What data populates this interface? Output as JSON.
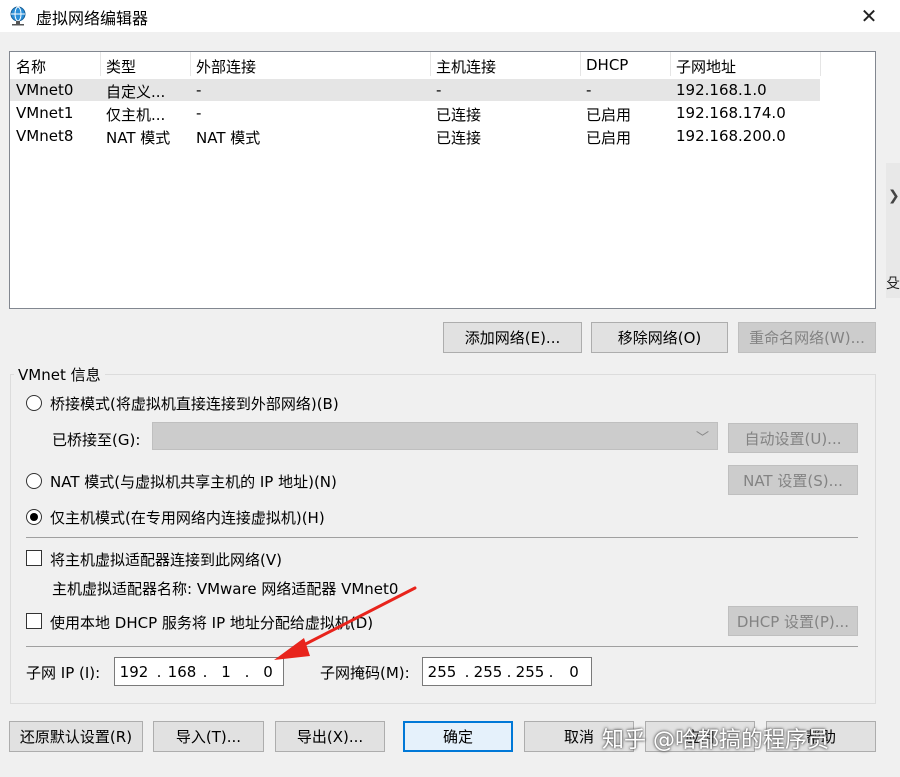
{
  "window": {
    "title": "虚拟网络编辑器",
    "icon": "network-globe-icon",
    "close_glyph": "✕"
  },
  "table": {
    "columns": [
      "名称",
      "类型",
      "外部连接",
      "主机连接",
      "DHCP",
      "子网地址"
    ],
    "rows": [
      [
        "VMnet0",
        "自定义...",
        "-",
        "-",
        "-",
        "192.168.1.0"
      ],
      [
        "VMnet1",
        "仅主机...",
        "-",
        "已连接",
        "已启用",
        "192.168.174.0"
      ],
      [
        "VMnet8",
        "NAT 模式",
        "NAT 模式",
        "已连接",
        "已启用",
        "192.168.200.0"
      ]
    ]
  },
  "table_buttons": {
    "add": "添加网络(E)...",
    "remove": "移除网络(O)",
    "rename": "重命名网络(W)..."
  },
  "vmnet": {
    "group_title": "VMnet 信息",
    "bridge_radio": "桥接模式(将虚拟机直接连接到外部网络)(B)",
    "bridged_to_label": "已桥接至(G):",
    "bridged_to_value": "",
    "auto_settings": "自动设置(U)...",
    "nat_radio": "NAT 模式(与虚拟机共享主机的 IP 地址)(N)",
    "nat_settings": "NAT 设置(S)...",
    "hostonly_radio": "仅主机模式(在专用网络内连接虚拟机)(H)",
    "selected_mode": "hostonly",
    "connect_adapter_check": "将主机虚拟适配器连接到此网络(V)",
    "adapter_name_text": "主机虚拟适配器名称: VMware 网络适配器 VMnet0",
    "dhcp_check": "使用本地 DHCP 服务将 IP 地址分配给虚拟机(D)",
    "dhcp_settings": "DHCP 设置(P)...",
    "subnet_ip_label": "子网 IP (I):",
    "subnet_ip": [
      "192",
      "168",
      "1",
      "0"
    ],
    "subnet_mask_label": "子网掩码(M):",
    "subnet_mask": [
      "255",
      "255",
      "255",
      "0"
    ],
    "ip_dot": "."
  },
  "footer": {
    "restore": "还原默认设置(R)",
    "import": "导入(T)...",
    "export": "导出(X)...",
    "ok": "确定",
    "cancel": "取消",
    "apply": "应用",
    "help": "帮助"
  },
  "overlay": {
    "watermark": "知乎 @哈都搞的程序员",
    "side_glyph": "❯",
    "side_char": "殳"
  },
  "colors": {
    "accent": "#0078d7",
    "arrow": "#e8241c",
    "selected_row": "#e5e5e5"
  }
}
